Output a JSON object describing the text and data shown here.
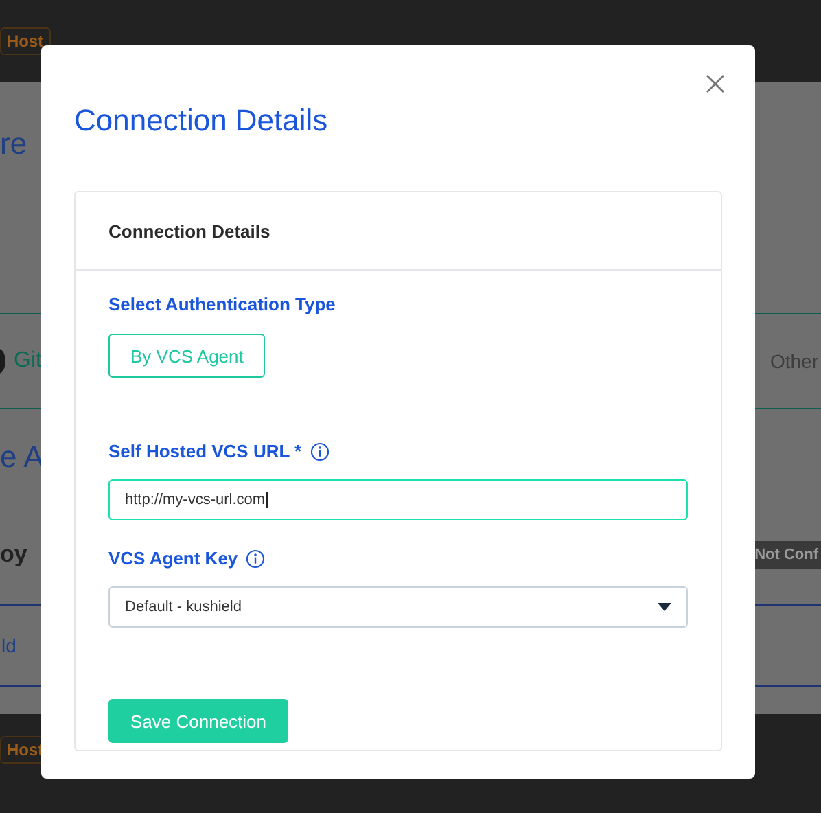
{
  "background": {
    "header_badge": "Host",
    "heading": "re",
    "tab_left": "Git",
    "tab_right": "Other",
    "section_heading": "e A",
    "row_label": "oy",
    "status_badge": "Not Conf",
    "link": "ld",
    "footer_badge": "Host"
  },
  "modal": {
    "title": "Connection Details",
    "card_title": "Connection Details",
    "auth_label": "Select Authentication Type",
    "auth_options": [
      {
        "label": "By VCS Agent",
        "selected": true
      }
    ],
    "fields": [
      {
        "kind": "text",
        "label": "Self Hosted VCS URL *",
        "info": true,
        "value": "http://my-vcs-url.com",
        "focused": true
      },
      {
        "kind": "select",
        "label": "VCS Agent Key",
        "info": true,
        "value": "Default - kushield"
      }
    ],
    "save_button": "Save Connection"
  }
}
